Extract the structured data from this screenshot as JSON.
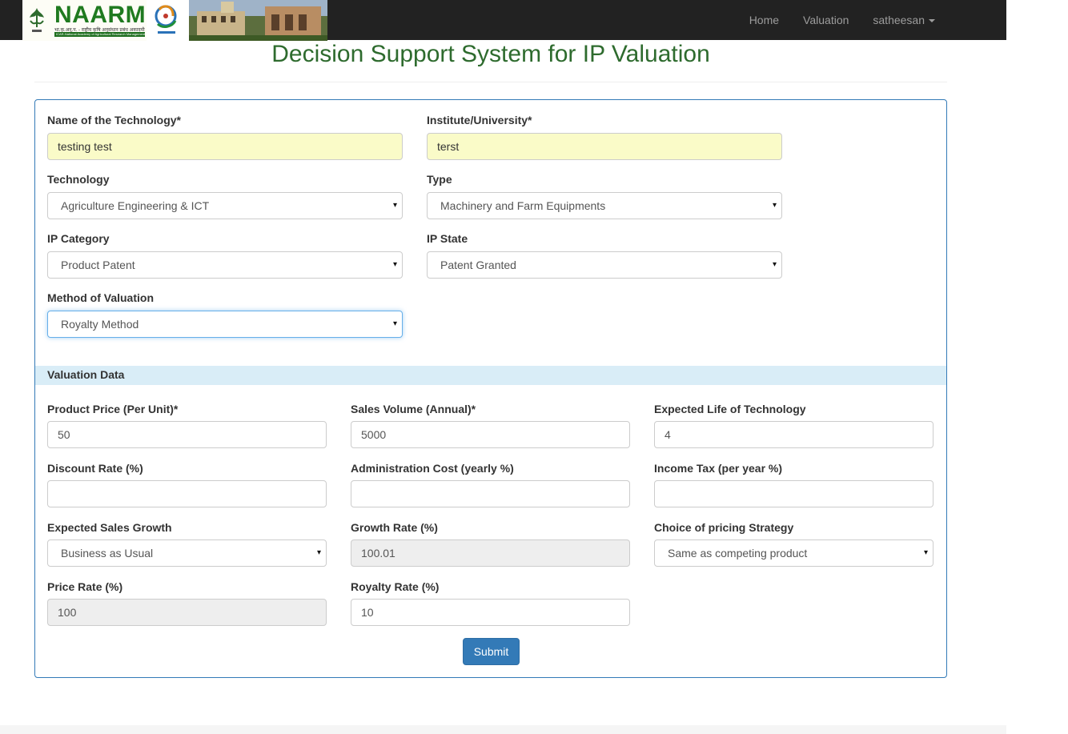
{
  "navbar": {
    "brand_name": "NAARM",
    "brand_hindi": "भा.कृ.अनु.प. - राष्ट्रीय कृषि अनुसंधान प्रबंध अकादमी",
    "brand_subtitle": "ICAR-National Academy of Agricultural Research Management",
    "links": [
      "Home",
      "Valuation"
    ],
    "user": "satheesan"
  },
  "page_title": "Decision Support System for IP Valuation",
  "form": {
    "name_of_technology": {
      "label": "Name of the Technology*",
      "value": "testing test"
    },
    "institute": {
      "label": "Institute/University*",
      "value": "terst"
    },
    "technology": {
      "label": "Technology",
      "value": "Agriculture Engineering & ICT"
    },
    "type": {
      "label": "Type",
      "value": "Machinery and Farm Equipments"
    },
    "ip_category": {
      "label": "IP Category",
      "value": "Product Patent"
    },
    "ip_state": {
      "label": "IP State",
      "value": "Patent Granted"
    },
    "method_of_valuation": {
      "label": "Method of Valuation",
      "value": "Royalty Method"
    }
  },
  "valuation": {
    "section_title": "Valuation Data",
    "product_price": {
      "label": "Product Price (Per Unit)*",
      "value": "50"
    },
    "sales_volume": {
      "label": "Sales Volume (Annual)*",
      "value": "5000"
    },
    "expected_life": {
      "label": "Expected Life of Technology",
      "value": "4"
    },
    "discount_rate": {
      "label": "Discount Rate (%)",
      "value": ""
    },
    "admin_cost": {
      "label": "Administration Cost (yearly %)",
      "value": ""
    },
    "income_tax": {
      "label": "Income Tax (per year %)",
      "value": ""
    },
    "sales_growth": {
      "label": "Expected Sales Growth",
      "value": "Business as Usual"
    },
    "growth_rate": {
      "label": "Growth Rate (%)",
      "value": "100.01"
    },
    "pricing_strategy": {
      "label": "Choice of pricing Strategy",
      "value": "Same as competing product"
    },
    "price_rate": {
      "label": "Price Rate (%)",
      "value": "100"
    },
    "royalty_rate": {
      "label": "Royalty Rate (%)",
      "value": "10"
    },
    "submit_label": "Submit"
  },
  "icons": {
    "select_arrow": "▾",
    "caret": "caret-down-icon"
  },
  "colors": {
    "navbar": "#222222",
    "title_green": "#2e6b2e",
    "panel_border": "#337ab7",
    "section_bg": "#d9edf7",
    "autofill_yellow": "#fafbc8",
    "submit_blue": "#337ab7"
  }
}
